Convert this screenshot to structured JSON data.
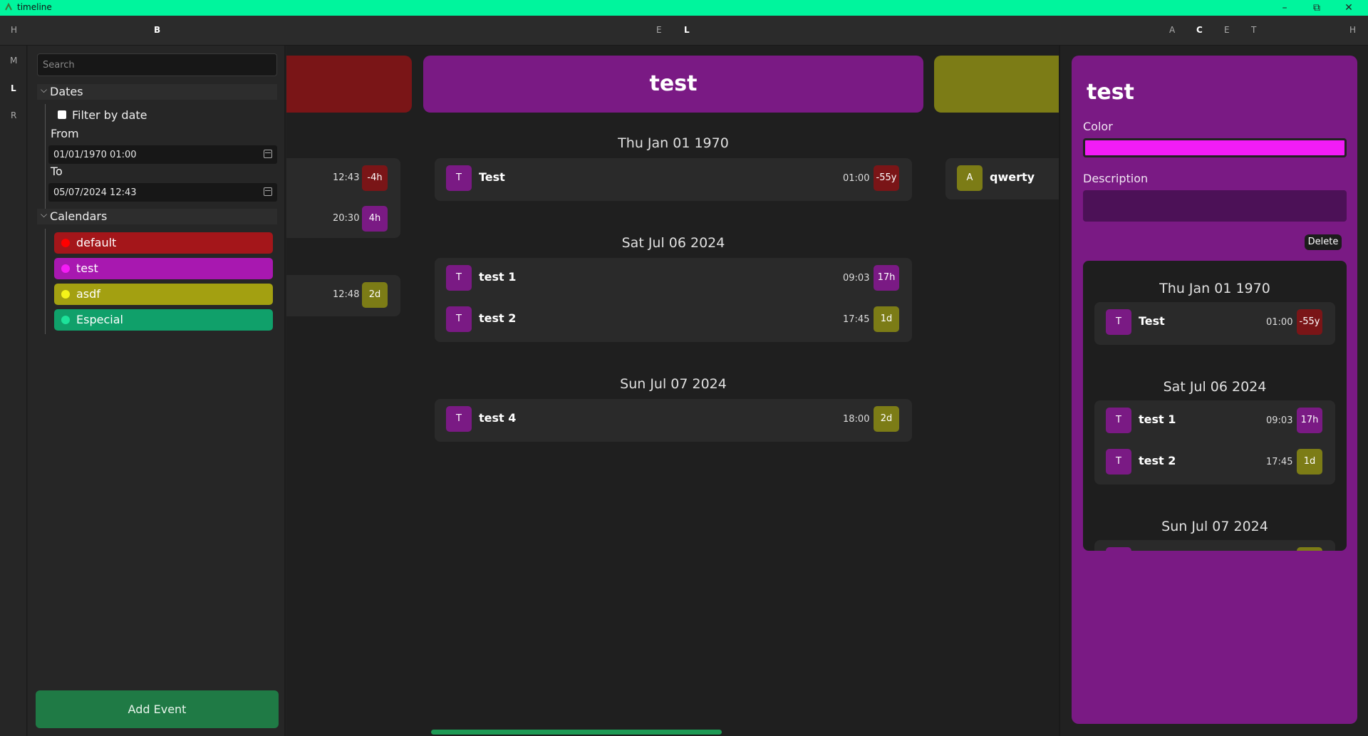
{
  "window": {
    "title": "timeline",
    "minimize": "–",
    "maximize": "⧉",
    "close": "✕"
  },
  "toolbar": {
    "h_left": "H",
    "b": "B",
    "e": "E",
    "l": "L",
    "a": "A",
    "c": "C",
    "e2": "E",
    "t": "T",
    "h_right": "H"
  },
  "rail": {
    "m": "M",
    "l": "L",
    "r": "R"
  },
  "sidebar": {
    "search_placeholder": "Search",
    "dates_header": "Dates",
    "filter_label": "Filter by date",
    "from_label": "From",
    "from_value": "01/01/1970 01:00",
    "to_label": "To",
    "to_value": "05/07/2024 12:43",
    "calendars_header": "Calendars",
    "calendars": [
      {
        "name": "default",
        "bg": "#a4161a",
        "dot": "#ff0000"
      },
      {
        "name": "test",
        "bg": "#a818b0",
        "dot": "#f41cf5"
      },
      {
        "name": "asdf",
        "bg": "#a3a011",
        "dot": "#f4f419"
      },
      {
        "name": "Especial",
        "bg": "#10a06a",
        "dot": "#1de29a"
      }
    ],
    "add_event": "Add Event"
  },
  "colors": {
    "default": "#7a1517",
    "test": "#7a1a84",
    "asdf": "#7c7c16"
  },
  "columns": {
    "default": {
      "events": [
        {
          "time": "12:43",
          "badge": "-4h",
          "badge_color": "#7a1517"
        },
        {
          "time": "20:30",
          "badge": "4h",
          "badge_color": "#7a1a84"
        },
        {
          "time": "12:48",
          "badge": "2d",
          "badge_color": "#7c7c16"
        }
      ]
    },
    "test": {
      "title": "test",
      "groups": [
        {
          "date": "Thu Jan 01 1970",
          "events": [
            {
              "initial": "T",
              "name": "Test",
              "time": "01:00",
              "badge": "-55y",
              "badge_color": "#7a1517"
            }
          ]
        },
        {
          "date": "Sat Jul 06 2024",
          "events": [
            {
              "initial": "T",
              "name": "test 1",
              "time": "09:03",
              "badge": "17h",
              "badge_color": "#7a1a84"
            },
            {
              "initial": "T",
              "name": "test 2",
              "time": "17:45",
              "badge": "1d",
              "badge_color": "#7c7c16"
            }
          ]
        },
        {
          "date": "Sun Jul 07 2024",
          "events": [
            {
              "initial": "T",
              "name": "test 4",
              "time": "18:00",
              "badge": "2d",
              "badge_color": "#7c7c16"
            }
          ]
        }
      ]
    },
    "asdf": {
      "events": [
        {
          "initial": "A",
          "name": "qwerty"
        }
      ]
    }
  },
  "detail": {
    "title": "test",
    "color_label": "Color",
    "color_value": "#f21cf6",
    "description_label": "Description",
    "delete": "Delete"
  }
}
